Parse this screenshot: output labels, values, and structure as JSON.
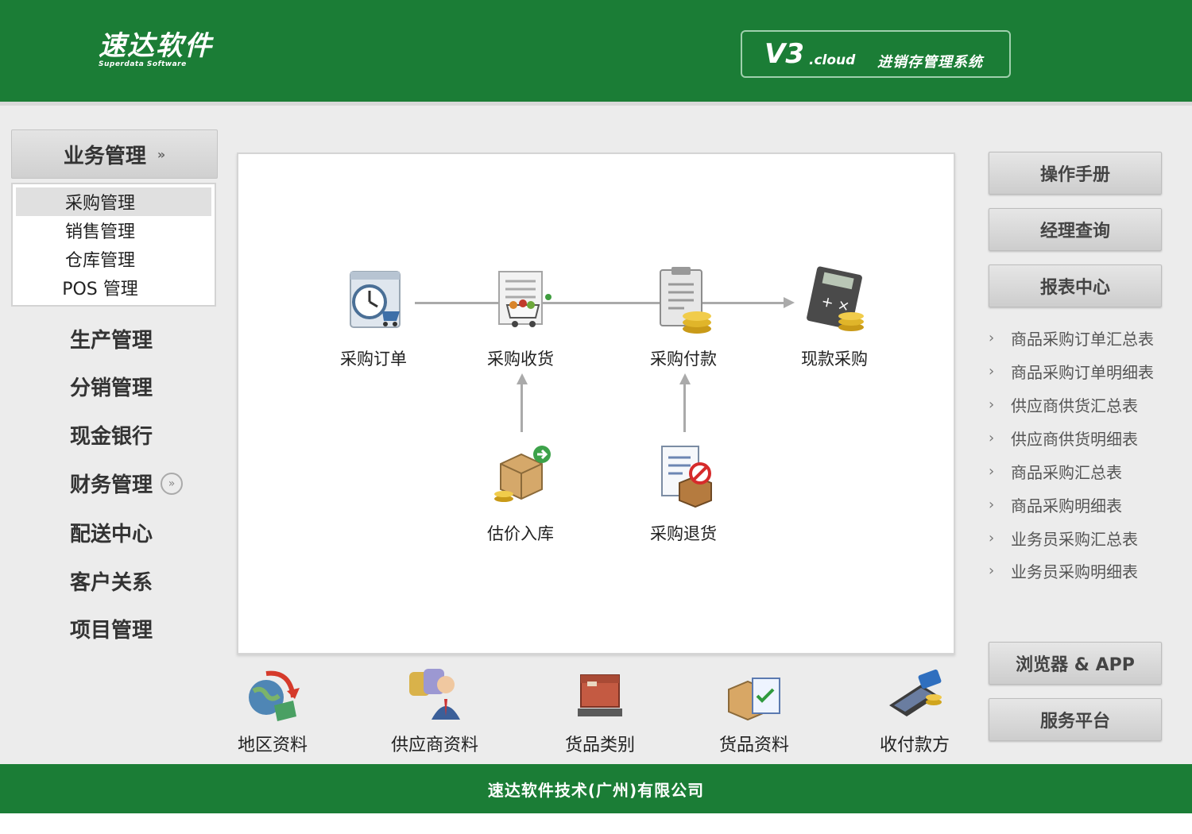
{
  "header": {
    "logo_cn": "速达软件",
    "logo_en": "Superdata Software",
    "version_main": "V3",
    "version_sub": ".cloud",
    "version_desc": "进销存管理系统"
  },
  "sidebar": {
    "module_label": "业务管理",
    "submenu": [
      {
        "label": "采购管理",
        "active": true
      },
      {
        "label": "销售管理"
      },
      {
        "label": "仓库管理"
      },
      {
        "label": "POS 管理"
      }
    ],
    "items": [
      {
        "label": "生产管理"
      },
      {
        "label": "分销管理"
      },
      {
        "label": "现金银行"
      },
      {
        "label": "财务管理"
      },
      {
        "label": "配送中心"
      },
      {
        "label": "客户关系"
      },
      {
        "label": "项目管理"
      }
    ]
  },
  "flow": {
    "nodes": [
      {
        "label": "采购订单",
        "icon": "clock-cart-icon"
      },
      {
        "label": "采购收货",
        "icon": "receipt-cart-icon"
      },
      {
        "label": "采购付款",
        "icon": "clipboard-coins-icon"
      },
      {
        "label": "现款采购",
        "icon": "calculator-coins-icon"
      },
      {
        "label": "估价入库",
        "icon": "boxes-arrow-icon"
      },
      {
        "label": "采购退货",
        "icon": "document-return-icon"
      }
    ]
  },
  "shortcuts": [
    {
      "label": "地区资料",
      "icon": "globe-arrow-icon"
    },
    {
      "label": "供应商资料",
      "icon": "people-icon"
    },
    {
      "label": "货品类别",
      "icon": "parcel-icon"
    },
    {
      "label": "货品资料",
      "icon": "box-checklist-icon"
    },
    {
      "label": "收付款方",
      "icon": "card-reader-icon"
    }
  ],
  "right": {
    "buttons": [
      {
        "label": "操作手册"
      },
      {
        "label": "经理查询"
      },
      {
        "label": "报表中心"
      }
    ],
    "reports": [
      {
        "label": "商品采购订单汇总表"
      },
      {
        "label": "商品采购订单明细表"
      },
      {
        "label": "供应商供货汇总表"
      },
      {
        "label": "供应商供货明细表"
      },
      {
        "label": "商品采购汇总表"
      },
      {
        "label": "商品采购明细表"
      },
      {
        "label": "业务员采购汇总表"
      },
      {
        "label": "业务员采购明细表"
      }
    ],
    "bottom_buttons": [
      {
        "label": "浏览器 & APP"
      },
      {
        "label": "服务平台"
      }
    ]
  },
  "footer": {
    "company": "速达软件技术(广州)有限公司"
  },
  "colors": {
    "brand_green": "#1b7d36",
    "band_gray": "#ececec"
  }
}
